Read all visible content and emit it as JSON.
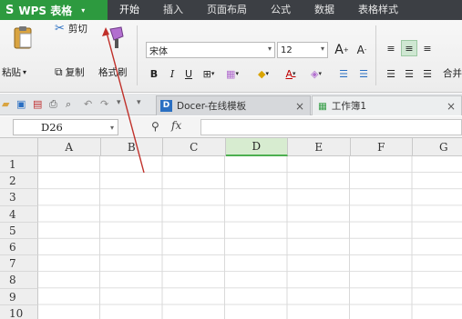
{
  "app": {
    "name": "WPS 表格",
    "logo": "S"
  },
  "menu": {
    "items": [
      "开始",
      "插入",
      "页面布局",
      "公式",
      "数据",
      "表格样式"
    ],
    "active": "开始"
  },
  "ribbon": {
    "paste": "粘贴",
    "cut": "剪切",
    "copy": "复制",
    "format_painter": "格式刷",
    "font_name": "宋体",
    "font_size": "12",
    "bold": "B",
    "italic": "I",
    "underline": "U",
    "font_color": "A",
    "grow_font": "A",
    "shrink_font": "A",
    "merge_partial": "合并"
  },
  "tabs": [
    {
      "label": "Docer-在线模板",
      "close": "×"
    },
    {
      "label": "工作簿1",
      "close": "×"
    }
  ],
  "formula_bar": {
    "cell_ref": "D26",
    "zoom_icon": "⚲",
    "fx": "fx",
    "value": ""
  },
  "grid": {
    "columns": [
      "A",
      "B",
      "C",
      "D",
      "E",
      "F",
      "G"
    ],
    "rows": [
      "1",
      "2",
      "3",
      "4",
      "5",
      "6",
      "7",
      "8",
      "9",
      "10"
    ],
    "selected_column": "D"
  },
  "colors": {
    "accent_green": "#2d9a3f",
    "menubar": "#3c3f44",
    "annotation_red": "#c0302a"
  }
}
